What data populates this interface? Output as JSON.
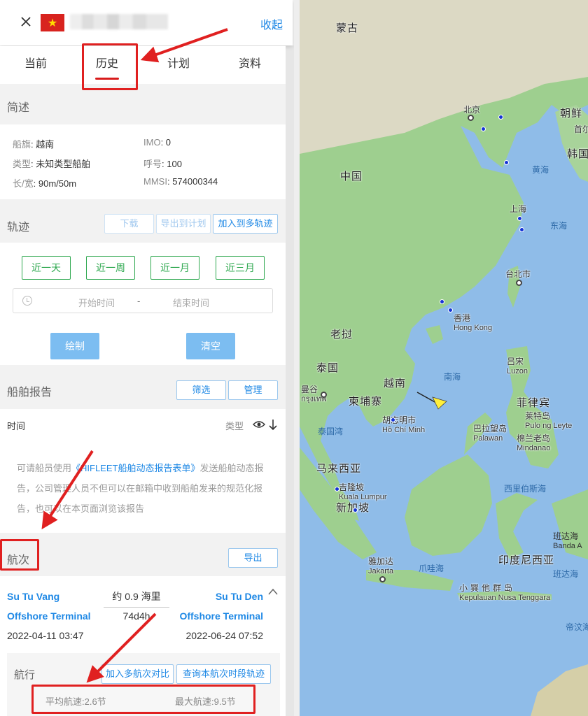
{
  "header": {
    "close_icon": "close-icon",
    "flag": "vietnam-flag",
    "collapse_label": "收起"
  },
  "tabs": [
    {
      "label": "当前",
      "active": false
    },
    {
      "label": "历史",
      "active": true
    },
    {
      "label": "计划",
      "active": false
    },
    {
      "label": "资料",
      "active": false
    }
  ],
  "summary": {
    "title": "简述",
    "flag_key": "船旗",
    "flag_value": "越南",
    "imo_key": "IMO",
    "imo_value": "0",
    "type_key": "类型",
    "type_value": "未知类型船舶",
    "callsign_key": "呼号",
    "callsign_value": "100",
    "size_key": "长/宽",
    "size_value": "90m/50m",
    "mmsi_key": "MMSI",
    "mmsi_value": "574000344"
  },
  "track": {
    "title": "轨迹",
    "download_label": "下载",
    "export_plan_label": "导出到计划",
    "add_multi_label": "加入到多轨迹",
    "quick_ranges": [
      "近一天",
      "近一周",
      "近一月",
      "近三月"
    ],
    "start_placeholder": "开始时间",
    "separator": "-",
    "end_placeholder": "结束时间",
    "draw_label": "绘制",
    "clear_label": "清空"
  },
  "report": {
    "title": "船舶报告",
    "filter_label": "筛选",
    "manage_label": "管理",
    "col_time": "时间",
    "col_type": "类型",
    "text_before": "可请船员使用",
    "link": "《HIFLEET船舶动态报告表单》",
    "text_after": "发送船舶动态报告，公司管理人员不但可以在邮箱中收到船舶发来的规范化报告，也可以在本页面浏览该报告"
  },
  "voyage": {
    "title": "航次",
    "export_label": "导出",
    "from_port_line1": "Su Tu Vang",
    "from_port_line2": "Offshore Terminal",
    "to_port_line1": "Su Tu Den",
    "to_port_line2": "Offshore Terminal",
    "distance": "约 0.9 海里",
    "duration": "74d4h",
    "depart_time": "2022-04-11 03:47",
    "arrive_time": "2022-06-24 07:52",
    "sailing_label": "航行",
    "add_compare_label": "加入多航次对比",
    "query_track_label": "查询本航次时段轨迹",
    "avg_speed": "平均航速:2.6节",
    "max_speed": "最大航速:9.5节"
  },
  "map": {
    "labels": {
      "mongolia": "蒙古",
      "beijing": "北京",
      "north_korea": "朝鲜",
      "seoul": "首尔",
      "south_korea": "韩国",
      "yellow_sea": "黄海",
      "china": "中国",
      "shanghai": "上海",
      "east_sea": "东海",
      "taipei": "台北市",
      "hongkong": "香港",
      "hongkong_en": "Hong Kong",
      "laos": "老挝",
      "south_china_sea": "南海",
      "luzon": "吕宋",
      "luzon_en": "Luzon",
      "thailand": "泰国",
      "vietnam": "越南",
      "bangkok": "曼谷",
      "bangkok_thai": "กรุงเทพ",
      "cambodia": "柬埔寨",
      "philippines": "菲律宾",
      "hcmc": "胡志明市",
      "hcmc_vi": "Hồ Chí Minh",
      "palawan": "巴拉望岛",
      "palawan_en": "Palawan",
      "pulong": "莱特岛",
      "pulong_en": "Pulo ng Leyte",
      "mindanao": "棉兰老岛",
      "mindanao_en": "Mindanao",
      "gulf_thailand": "泰国湾",
      "malaysia": "马来西亚",
      "kl": "吉隆坡",
      "kl_en": "Kuala Lumpur",
      "singapore": "新加坡",
      "celebes_sea": "西里伯斯海",
      "banda": "班达海",
      "banda_en": "Banda A",
      "jakarta": "雅加达",
      "jakarta_en": "Jakarta",
      "java_sea": "爪哇海",
      "indonesia": "印度尼西亚",
      "lesser_sunda": "小巽他群岛",
      "lesser_sunda_en": "Kepulauan Nusa Tenggara",
      "banda2": "班达海",
      "timor": "帝汶海"
    }
  }
}
